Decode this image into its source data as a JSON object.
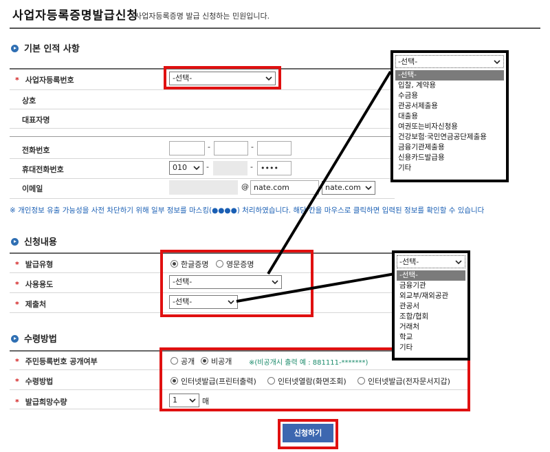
{
  "page": {
    "title": "사업자등록증명발급신청",
    "subtitle": "사업자등록증명 발급 신청하는 민원입니다."
  },
  "sections": {
    "basic": "기본 인적 사항",
    "request": "신청내용",
    "receive": "수령방법"
  },
  "basic": {
    "bizno_label": "사업자등록번호",
    "bizno_value": "-선택-",
    "company_label": "상호",
    "ceo_label": "대표자명",
    "phone_label": "전화번호",
    "phone_sep": "-",
    "mobile_label": "휴대전화번호",
    "mobile_prefix": "010",
    "mobile_last": "••••",
    "email_label": "이메일",
    "email_at": "@",
    "email_domain": "nate.com",
    "email_domain_select": "nate.com"
  },
  "notice": "※ 개인정보 유출 가능성을 사전 차단하기 위해 일부 정보를 마스킹(●●●●) 처리하였습니다. 해당 칸을 마우스로 클릭하면 입력된 정보를 확인할 수 있습니다",
  "request": {
    "type_label": "발급유형",
    "type_options": [
      "한글증명",
      "영문증명"
    ],
    "purpose_label": "사용용도",
    "purpose_value": "-선택-",
    "submit_to_label": "제출처",
    "submit_to_value": "-선택-"
  },
  "receive": {
    "rrn_label": "주민등록번호 공개여부",
    "rrn_options": [
      "공개",
      "비공개"
    ],
    "rrn_hint": "※(비공개시 출력 예 : 881111-*******)",
    "method_label": "수령방법",
    "method_options": [
      "인터넷발급(프린터출력)",
      "인터넷열람(화면조회)",
      "인터넷발급(전자문서지갑)"
    ],
    "qty_label": "발급희망수량",
    "qty_value": "1",
    "qty_unit": "매"
  },
  "submit_label": "신청하기",
  "dropdown_purpose": {
    "head": "-선택-",
    "items": [
      "-선택-",
      "입찰, 계약용",
      "수금용",
      "관공서제출용",
      "대출용",
      "여권또는비자신청용",
      "건강보험·국민연금공단제출용",
      "금융기관제출용",
      "신용카드발급용",
      "기타"
    ],
    "selected_index": 0
  },
  "dropdown_submit_to": {
    "head": "-선택-",
    "items": [
      "-선택-",
      "금융기관",
      "외교부/재외공관",
      "관공서",
      "조합/협회",
      "거래처",
      "학교",
      "기타"
    ],
    "selected_index": 0
  },
  "colors": {
    "highlight_red": "#e01010",
    "submit_blue": "#3d67b0",
    "notice_blue": "#1a5fb4",
    "required_red": "#d21f1f"
  }
}
